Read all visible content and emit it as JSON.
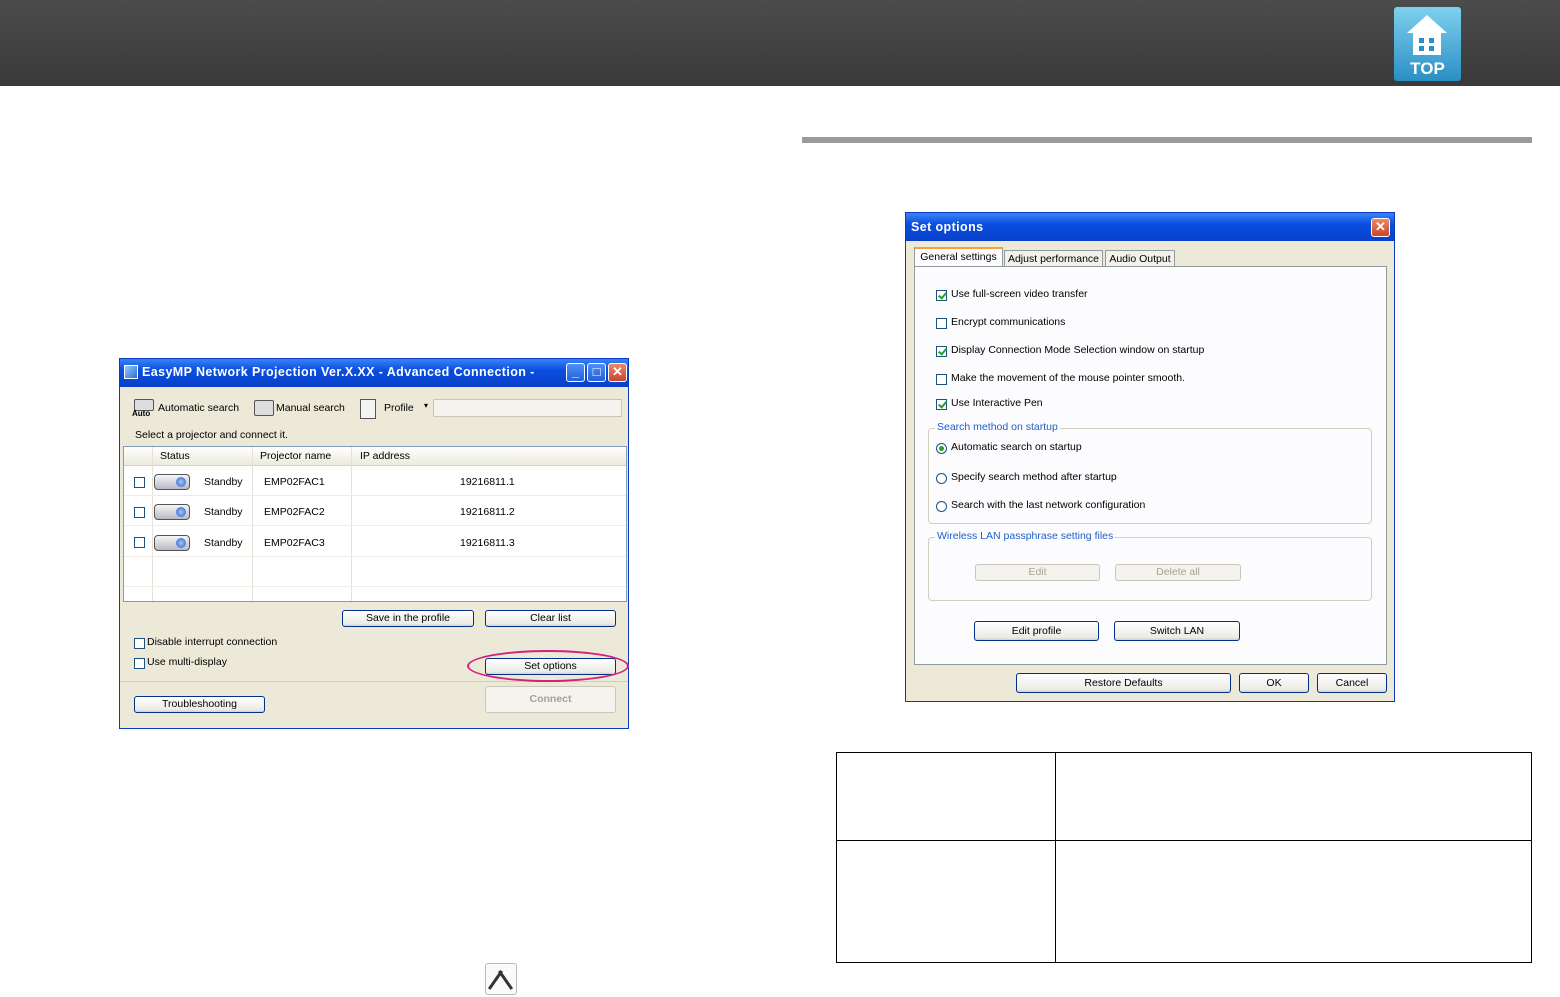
{
  "header": {
    "top_label": "TOP",
    "top_icon": "home-icon"
  },
  "advanced_window": {
    "title": "EasyMP Network Projection Ver.X.XX - Advanced Connection -",
    "toolbar": {
      "auto_icon_text": "Auto",
      "automatic_search": "Automatic search",
      "manual_search": "Manual search",
      "profile": "Profile",
      "profile_arrow": "▾"
    },
    "instruction": "Select a projector and connect it.",
    "columns": [
      "Status",
      "Projector name",
      "IP address"
    ],
    "rows": [
      {
        "status": "Standby",
        "name": "EMP02FAC1",
        "ip": "19216811.1"
      },
      {
        "status": "Standby",
        "name": "EMP02FAC2",
        "ip": "19216811.2"
      },
      {
        "status": "Standby",
        "name": "EMP02FAC3",
        "ip": "19216811.3"
      }
    ],
    "save_profile": "Save in the profile",
    "clear_list": "Clear list",
    "disable_interrupt": "Disable interrupt connection",
    "use_multi_display": "Use multi-display",
    "set_options": "Set options",
    "troubleshooting": "Troubleshooting",
    "connect": "Connect"
  },
  "options_window": {
    "title": "Set options",
    "tabs": [
      "General settings",
      "Adjust performance",
      "Audio Output"
    ],
    "options": [
      {
        "label": "Use full-screen video transfer",
        "checked": true
      },
      {
        "label": "Encrypt communications",
        "checked": false
      },
      {
        "label": "Display Connection Mode Selection window on startup",
        "checked": true
      },
      {
        "label": "Make the movement of the mouse pointer smooth.",
        "checked": false
      },
      {
        "label": "Use Interactive Pen",
        "checked": true
      }
    ],
    "search_group": {
      "title": "Search method on startup",
      "radios": [
        {
          "label": "Automatic search on startup",
          "selected": true
        },
        {
          "label": "Specify search method after startup",
          "selected": false
        },
        {
          "label": "Search with the last network configuration",
          "selected": false
        }
      ]
    },
    "wireless_group": {
      "title": "Wireless LAN passphrase setting files",
      "edit": "Edit",
      "delete_all": "Delete all"
    },
    "edit_profile": "Edit profile",
    "switch_lan": "Switch LAN",
    "restore_defaults": "Restore Defaults",
    "ok": "OK",
    "cancel": "Cancel"
  },
  "colors": {
    "header_bg": "#3f3f3f",
    "highlight_oval": "#d4207a",
    "xp_title_blue": "#0a4ee0"
  },
  "bottom_icon": "tools-icon"
}
